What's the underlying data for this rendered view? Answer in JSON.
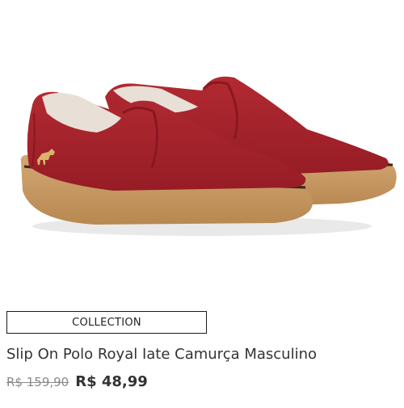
{
  "product": {
    "badge": "COLLECTION",
    "title": "Slip On Polo Royal Iate Camurça Masculino",
    "old_price": "R$ 159,90",
    "price": "R$ 48,99",
    "image_name": "red-suede-slip-on-shoes",
    "colors": {
      "upper": "#a8202a",
      "sole": "#c89a63",
      "stripe": "#3a2518",
      "lining": "#e8dfd6",
      "logo": "#d9b46a"
    }
  }
}
